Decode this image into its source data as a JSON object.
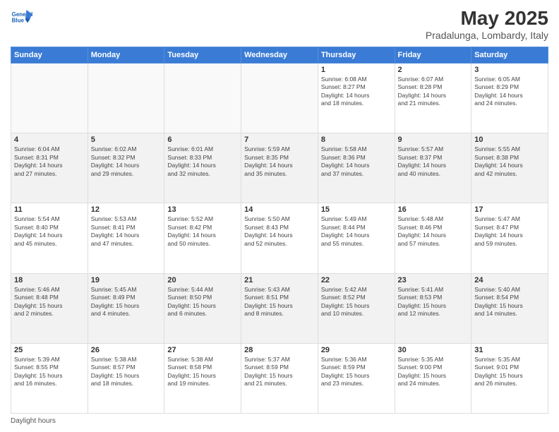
{
  "header": {
    "logo_line1": "General",
    "logo_line2": "Blue",
    "month": "May 2025",
    "location": "Pradalunga, Lombardy, Italy"
  },
  "days_of_week": [
    "Sunday",
    "Monday",
    "Tuesday",
    "Wednesday",
    "Thursday",
    "Friday",
    "Saturday"
  ],
  "weeks": [
    [
      {
        "num": "",
        "info": ""
      },
      {
        "num": "",
        "info": ""
      },
      {
        "num": "",
        "info": ""
      },
      {
        "num": "",
        "info": ""
      },
      {
        "num": "1",
        "info": "Sunrise: 6:08 AM\nSunset: 8:27 PM\nDaylight: 14 hours\nand 18 minutes."
      },
      {
        "num": "2",
        "info": "Sunrise: 6:07 AM\nSunset: 8:28 PM\nDaylight: 14 hours\nand 21 minutes."
      },
      {
        "num": "3",
        "info": "Sunrise: 6:05 AM\nSunset: 8:29 PM\nDaylight: 14 hours\nand 24 minutes."
      }
    ],
    [
      {
        "num": "4",
        "info": "Sunrise: 6:04 AM\nSunset: 8:31 PM\nDaylight: 14 hours\nand 27 minutes."
      },
      {
        "num": "5",
        "info": "Sunrise: 6:02 AM\nSunset: 8:32 PM\nDaylight: 14 hours\nand 29 minutes."
      },
      {
        "num": "6",
        "info": "Sunrise: 6:01 AM\nSunset: 8:33 PM\nDaylight: 14 hours\nand 32 minutes."
      },
      {
        "num": "7",
        "info": "Sunrise: 5:59 AM\nSunset: 8:35 PM\nDaylight: 14 hours\nand 35 minutes."
      },
      {
        "num": "8",
        "info": "Sunrise: 5:58 AM\nSunset: 8:36 PM\nDaylight: 14 hours\nand 37 minutes."
      },
      {
        "num": "9",
        "info": "Sunrise: 5:57 AM\nSunset: 8:37 PM\nDaylight: 14 hours\nand 40 minutes."
      },
      {
        "num": "10",
        "info": "Sunrise: 5:55 AM\nSunset: 8:38 PM\nDaylight: 14 hours\nand 42 minutes."
      }
    ],
    [
      {
        "num": "11",
        "info": "Sunrise: 5:54 AM\nSunset: 8:40 PM\nDaylight: 14 hours\nand 45 minutes."
      },
      {
        "num": "12",
        "info": "Sunrise: 5:53 AM\nSunset: 8:41 PM\nDaylight: 14 hours\nand 47 minutes."
      },
      {
        "num": "13",
        "info": "Sunrise: 5:52 AM\nSunset: 8:42 PM\nDaylight: 14 hours\nand 50 minutes."
      },
      {
        "num": "14",
        "info": "Sunrise: 5:50 AM\nSunset: 8:43 PM\nDaylight: 14 hours\nand 52 minutes."
      },
      {
        "num": "15",
        "info": "Sunrise: 5:49 AM\nSunset: 8:44 PM\nDaylight: 14 hours\nand 55 minutes."
      },
      {
        "num": "16",
        "info": "Sunrise: 5:48 AM\nSunset: 8:46 PM\nDaylight: 14 hours\nand 57 minutes."
      },
      {
        "num": "17",
        "info": "Sunrise: 5:47 AM\nSunset: 8:47 PM\nDaylight: 14 hours\nand 59 minutes."
      }
    ],
    [
      {
        "num": "18",
        "info": "Sunrise: 5:46 AM\nSunset: 8:48 PM\nDaylight: 15 hours\nand 2 minutes."
      },
      {
        "num": "19",
        "info": "Sunrise: 5:45 AM\nSunset: 8:49 PM\nDaylight: 15 hours\nand 4 minutes."
      },
      {
        "num": "20",
        "info": "Sunrise: 5:44 AM\nSunset: 8:50 PM\nDaylight: 15 hours\nand 6 minutes."
      },
      {
        "num": "21",
        "info": "Sunrise: 5:43 AM\nSunset: 8:51 PM\nDaylight: 15 hours\nand 8 minutes."
      },
      {
        "num": "22",
        "info": "Sunrise: 5:42 AM\nSunset: 8:52 PM\nDaylight: 15 hours\nand 10 minutes."
      },
      {
        "num": "23",
        "info": "Sunrise: 5:41 AM\nSunset: 8:53 PM\nDaylight: 15 hours\nand 12 minutes."
      },
      {
        "num": "24",
        "info": "Sunrise: 5:40 AM\nSunset: 8:54 PM\nDaylight: 15 hours\nand 14 minutes."
      }
    ],
    [
      {
        "num": "25",
        "info": "Sunrise: 5:39 AM\nSunset: 8:55 PM\nDaylight: 15 hours\nand 16 minutes."
      },
      {
        "num": "26",
        "info": "Sunrise: 5:38 AM\nSunset: 8:57 PM\nDaylight: 15 hours\nand 18 minutes."
      },
      {
        "num": "27",
        "info": "Sunrise: 5:38 AM\nSunset: 8:58 PM\nDaylight: 15 hours\nand 19 minutes."
      },
      {
        "num": "28",
        "info": "Sunrise: 5:37 AM\nSunset: 8:59 PM\nDaylight: 15 hours\nand 21 minutes."
      },
      {
        "num": "29",
        "info": "Sunrise: 5:36 AM\nSunset: 8:59 PM\nDaylight: 15 hours\nand 23 minutes."
      },
      {
        "num": "30",
        "info": "Sunrise: 5:35 AM\nSunset: 9:00 PM\nDaylight: 15 hours\nand 24 minutes."
      },
      {
        "num": "31",
        "info": "Sunrise: 5:35 AM\nSunset: 9:01 PM\nDaylight: 15 hours\nand 26 minutes."
      }
    ]
  ],
  "footer": "Daylight hours"
}
